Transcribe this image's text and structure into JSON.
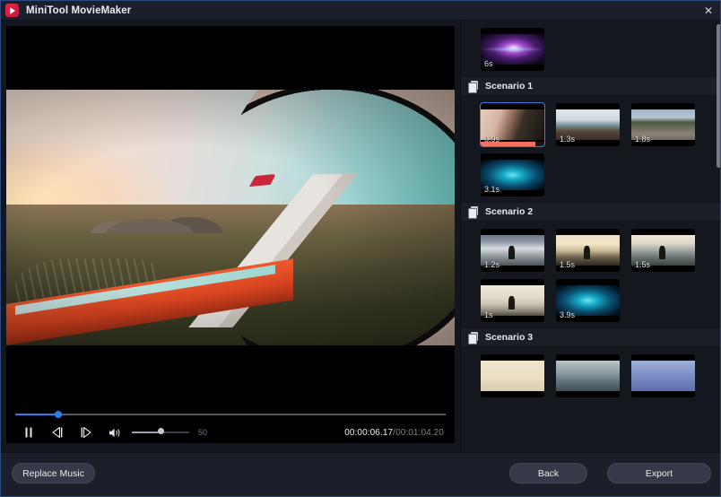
{
  "window": {
    "title": "MiniTool MovieMaker",
    "logo_icon": "moviemaker-play-logo",
    "close_icon": "✕"
  },
  "player": {
    "pause_icon": "❘❘",
    "prev_frame_icon": "◁❘",
    "next_frame_icon": "❘▷",
    "volume_icon": "🔊",
    "volume_value": "50",
    "volume_percent": 50,
    "seek_percent": 10,
    "current_time": "00:00:06.17",
    "time_separator": "/",
    "total_time": "00:01:04.20",
    "preview_description": "airplane wing seen through cabin window at sunset"
  },
  "clips_panel": {
    "scroll_position": "near-top",
    "sections": [
      {
        "label": "",
        "has_header": false,
        "icon": "",
        "clips": [
          {
            "duration": "6s",
            "art": "t-space",
            "selected": false,
            "progress": 0
          }
        ]
      },
      {
        "label": "Scenario 1",
        "has_header": true,
        "icon": "layers-icon",
        "clips": [
          {
            "duration": "0.9s",
            "art": "t-plane",
            "selected": true,
            "progress": 86
          },
          {
            "duration": "1.3s",
            "art": "t-beach",
            "selected": false,
            "progress": 0
          },
          {
            "duration": "1.8s",
            "art": "t-rocks",
            "selected": false,
            "progress": 0
          },
          {
            "duration": "3.1s",
            "art": "t-wave",
            "selected": false,
            "progress": 0
          }
        ]
      },
      {
        "label": "Scenario 2",
        "has_header": true,
        "icon": "layers-icon",
        "clips": [
          {
            "duration": "1.2s",
            "art": "t-bike",
            "selected": false,
            "progress": 0
          },
          {
            "duration": "1.5s",
            "art": "t-surf1",
            "selected": false,
            "progress": 0
          },
          {
            "duration": "1.5s",
            "art": "t-surf2",
            "selected": false,
            "progress": 0
          },
          {
            "duration": "1s",
            "art": "t-surf3",
            "selected": false,
            "progress": 0
          },
          {
            "duration": "3.9s",
            "art": "t-wave",
            "selected": false,
            "progress": 0
          }
        ]
      },
      {
        "label": "Scenario 3",
        "has_header": true,
        "icon": "layers-icon",
        "clips": [
          {
            "duration": "",
            "art": "t-cream",
            "selected": false,
            "progress": 0
          },
          {
            "duration": "",
            "art": "t-sea",
            "selected": false,
            "progress": 0
          },
          {
            "duration": "",
            "art": "t-blue",
            "selected": false,
            "progress": 0
          }
        ]
      }
    ]
  },
  "footer": {
    "replace_music_label": "Replace Music",
    "back_label": "Back",
    "export_label": "Export"
  },
  "colors": {
    "accent_blue": "#2a7ff0",
    "selection_blue": "#3d7fe0",
    "progress_red": "#f4705f",
    "titlebar": "#1b1f2a",
    "panel": "#15171e",
    "window_border": "#2b4a84"
  }
}
